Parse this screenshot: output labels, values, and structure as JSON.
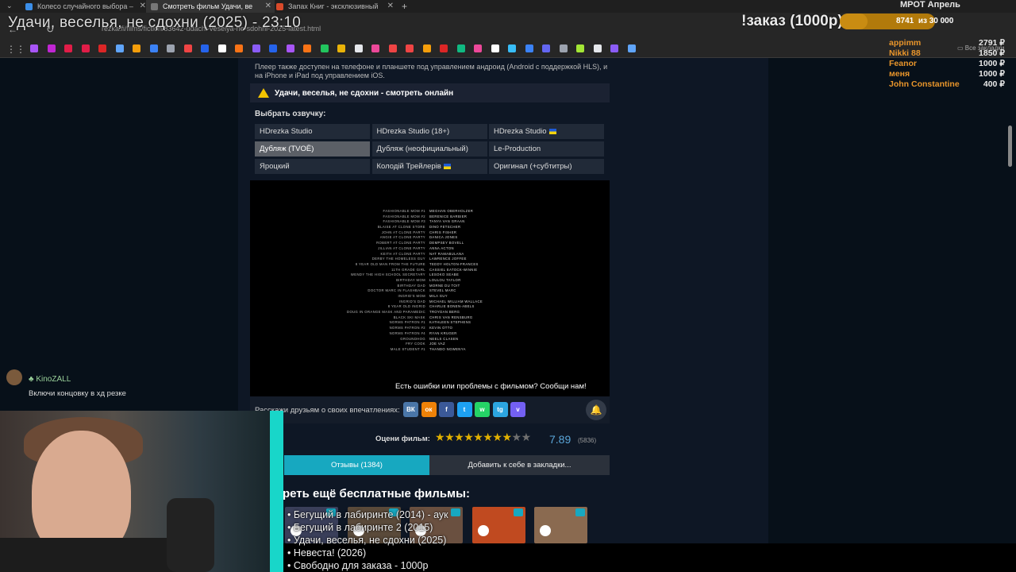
{
  "browser": {
    "tabs": [
      {
        "title": "Колесо случайного выбора –",
        "fav": "#3b8ee8"
      },
      {
        "title": "Смотреть фильм Удачи, ве",
        "fav": "#777"
      },
      {
        "title": "Запах Книг - эксклюзивный",
        "fav": "#d84a2a"
      }
    ],
    "new_tab": "+",
    "url": "rezka.fi/films/fiction/83642-udachi-veselya-ne-sdohni-2025-latest.html",
    "bookmarks_label": "Все закладки"
  },
  "overlay": {
    "stream_title": "Удачи, веселья, не сдохни (2025) - 23:10",
    "order_text": "!заказ (1000р)",
    "progress_current": "8741",
    "progress_sep": "из",
    "progress_goal": "30 000",
    "progress_fraction": 0.29,
    "mrot_text": "МРОТ Апрель",
    "donors": [
      {
        "name": "appimm",
        "amount": "2791 ₽"
      },
      {
        "name": "Nikki 88",
        "amount": "1850 ₽"
      },
      {
        "name": "Feanor",
        "amount": "1000 ₽"
      },
      {
        "name": "меня",
        "amount": "1000 ₽"
      },
      {
        "name": "John Constantine",
        "amount": "400 ₽"
      }
    ],
    "ticker": [
      "• Бегущий в лабиринте (2014) - аук",
      "• Бегущий в лабиринте 2 (2015)",
      "• Удачи, веселья, не сдохни (2025)",
      "• Невеста! (2026)",
      "• Свободно для заказа - 1000р"
    ]
  },
  "page": {
    "notice": "Плеер также доступен на телефоне и планшете под управлением андроид (Android с поддержкой HLS), и на iPhone и iPad под управлением iOS.",
    "player_title": "Удачи, веселья, не сдохни - смотреть онлайн",
    "voice_label": "Выбрать озвучку:",
    "voices": [
      {
        "label": "HDrezka Studio",
        "flag": false,
        "selected": false
      },
      {
        "label": "HDrezka Studio (18+)",
        "flag": false,
        "selected": false
      },
      {
        "label": "HDrezka Studio",
        "flag": true,
        "selected": false
      },
      {
        "label": "Дубляж (TVOЁ)",
        "flag": false,
        "selected": true
      },
      {
        "label": "Дубляж (неофициальный)",
        "flag": false,
        "selected": false
      },
      {
        "label": "Le-Production",
        "flag": false,
        "selected": false
      },
      {
        "label": "Яроцкий",
        "flag": false,
        "selected": false
      },
      {
        "label": "Колодій Трейлерів",
        "flag": true,
        "selected": false
      },
      {
        "label": "Оригинал (+субтитры)",
        "flag": false,
        "selected": false
      }
    ],
    "credits": [
      [
        "FASHIONABLE MOM #1",
        "MEGHAN OBERHOLZER"
      ],
      [
        "FASHIONABLE MOM #2",
        "BERENICE BARBIER"
      ],
      [
        "FASHIONABLE MOM #3",
        "TANYA VAN GRAAN"
      ],
      [
        "BLAISE AT CLONE STORE",
        "DINO FETSCHER"
      ],
      [
        "JOHN AT CLONE PARTY",
        "CHRIS FISHER"
      ],
      [
        "ANGIE AT CLONE PARTY",
        "DANICA JONES"
      ],
      [
        "ROBERT AT CLONE PARTY",
        "DEMPSEY BOVELL"
      ],
      [
        "JILLIAN AT CLONE PARTY",
        "ANNA ACTON"
      ],
      [
        "KEITH AT CLONE PARTY",
        "NAT RAMABULANA"
      ],
      [
        "DERBY THE HOMELESS GUY",
        "LAWRENCE JOFFEE"
      ],
      [
        "8 YEAR OLD MAN FROM THE FUTURE",
        "TEDDY HOLTON-FRANCES"
      ],
      [
        "11TH GRADE GIRL",
        "CASSIEL EATOCK-WINNIE"
      ],
      [
        "WENDY THE HIGH SCHOOL SECRETARY",
        "LESOKO SEABE"
      ],
      [
        "BIRTHDAY MOM",
        "LOULOU TAYLOR"
      ],
      [
        "BIRTHDAY DAD",
        "MORNE DU TOIT"
      ],
      [
        "DOCTOR MARC IN FLASHBACK",
        "STEVEL MARC"
      ],
      [
        "INGRID'S MOM",
        "MILA GUY"
      ],
      [
        "INGRID'S DAD",
        "MICHAEL WILLIAM WALLACE"
      ],
      [
        "8 YEAR OLD INGRID",
        "CHARLIE BONEN-ABELS"
      ],
      [
        "DOUG IN ORANGE MASK AND PARAMEDIC",
        "TROYDAN BERG"
      ],
      [
        "BLACK SKI MASK",
        "CHRIS VAN RENSBURG"
      ],
      [
        "NORMS PATRON #1",
        "KATHLEEN STEPHENS"
      ],
      [
        "NORMS PATRON #2",
        "KEVIN OTTO"
      ],
      [
        "NORMS PATRON #4",
        "RYAN KRUGER"
      ],
      [
        "GROUNDHOG",
        "NEELS CLASEN"
      ],
      [
        "FRY COOK",
        "JOE VAZ"
      ],
      [
        "MALE STUDENT #1",
        "THANDO NGWENYA"
      ]
    ],
    "report_link": "Есть ошибки или проблемы с фильмом? Сообщи нам!",
    "share_label": "Расскажи друзьям о своих впечатлениях:",
    "social": [
      {
        "name": "vk",
        "label": "ВК",
        "color": "#4a76a8"
      },
      {
        "name": "ok",
        "label": "ок",
        "color": "#ee8208"
      },
      {
        "name": "facebook",
        "label": "f",
        "color": "#3b5998"
      },
      {
        "name": "twitter",
        "label": "t",
        "color": "#1da1f2"
      },
      {
        "name": "whatsapp",
        "label": "w",
        "color": "#25d366"
      },
      {
        "name": "telegram",
        "label": "tg",
        "color": "#2ca5e0"
      },
      {
        "name": "viber",
        "label": "v",
        "color": "#7360f2"
      }
    ],
    "rate_label": "Оцени фильм:",
    "stars_filled": 8,
    "stars_total": 10,
    "rating": "7.89",
    "votes": "(5836)",
    "reviews_tab": "Отзывы (1384)",
    "bookmark_tab": "Добавить к себе в закладки...",
    "more_title": "реть ещё бесплатные фильмы:",
    "thumb_colors": [
      "#3a3f5a",
      "#5a4a3a",
      "#6a5040",
      "#c04a20",
      "#8a6a50"
    ]
  },
  "chat": {
    "user": "KinoZALL",
    "message": "Включи концовку в хд резке"
  }
}
